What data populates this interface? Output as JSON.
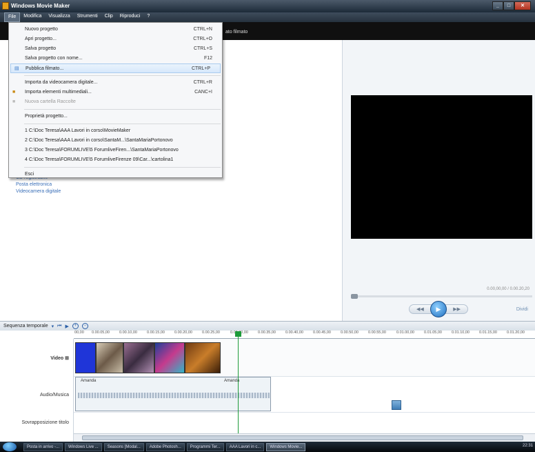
{
  "window": {
    "title": "Windows Movie Maker"
  },
  "menubar": {
    "items": [
      "File",
      "Modifica",
      "Visualizza",
      "Strumenti",
      "Clip",
      "Riproduci",
      "?"
    ]
  },
  "toolbar": {
    "label": "ato filmato"
  },
  "file_menu": {
    "items": [
      {
        "label": "Nuovo progetto",
        "shortcut": "CTRL+N"
      },
      {
        "label": "Apri progetto...",
        "shortcut": "CTRL+O"
      },
      {
        "label": "Salva progetto",
        "shortcut": "CTRL+S"
      },
      {
        "label": "Salva progetto con nome...",
        "shortcut": "F12"
      },
      {
        "label": "Pubblica filmato...",
        "shortcut": "CTRL+P"
      },
      {
        "label": "Importa da videocamera digitale...",
        "shortcut": "CTRL+R"
      },
      {
        "label": "Importa elementi multimediali...",
        "shortcut": "CANC+I"
      },
      {
        "label": "Nuova cartella Raccolte",
        "shortcut": ""
      },
      {
        "label": "Proprietà progetto...",
        "shortcut": ""
      },
      {
        "label": "1 C:\\Doc Teresa\\AAA Lavori in corso\\MovieMaker",
        "shortcut": ""
      },
      {
        "label": "2 C:\\Doc Teresa\\AAA Lavori in corso\\SantaM...\\SantaMariaPortonovo",
        "shortcut": ""
      },
      {
        "label": "3 C:\\Doc Teresa\\FORUMLIVE\\5 ForumliveFiren...\\SantaMariaPortonovo",
        "shortcut": ""
      },
      {
        "label": "4 C:\\Doc Teresa\\FORUMLIVE\\5 ForumliveFirenze 09\\Car...\\cartolina1",
        "shortcut": ""
      },
      {
        "label": "Esci",
        "shortcut": ""
      }
    ]
  },
  "tasks": {
    "links": [
      "CD registrabile",
      "Posta elettronica",
      "Videocamera digitale"
    ]
  },
  "preview": {
    "time": "0.00,00,00 / 0.00.20,20",
    "split_label": "Dividi",
    "play_glyph": "▶"
  },
  "timeline": {
    "view_label": "Sequenza temporale",
    "ruler": [
      "00,00",
      "0.00.05,00",
      "0.00.10,00",
      "0.00.15,00",
      "0.00.20,00",
      "0.00.25,00",
      "0.00.30,00",
      "0.00.35,00",
      "0.00.40,00",
      "0.00.45,00",
      "0.00.50,00",
      "0.00.55,00",
      "0.01.00,00",
      "0.01.05,00",
      "0.01.10,00",
      "0.01.15,00",
      "0.01.20,00"
    ],
    "tracks": {
      "video": "Video",
      "audio": "Audio/Musica",
      "title": "Sovrapposizione titolo"
    },
    "audio_clips": [
      "Amanda",
      "Amanda"
    ]
  },
  "taskbar": {
    "buttons": [
      "Posta in arrivo -...",
      "Windows Live ...",
      "Seasons [Modal...",
      "Adobe Photosh...",
      "Programmi Ter...",
      "AAA Lavori in c...",
      "Windows Movie..."
    ],
    "clock": "22:31"
  }
}
